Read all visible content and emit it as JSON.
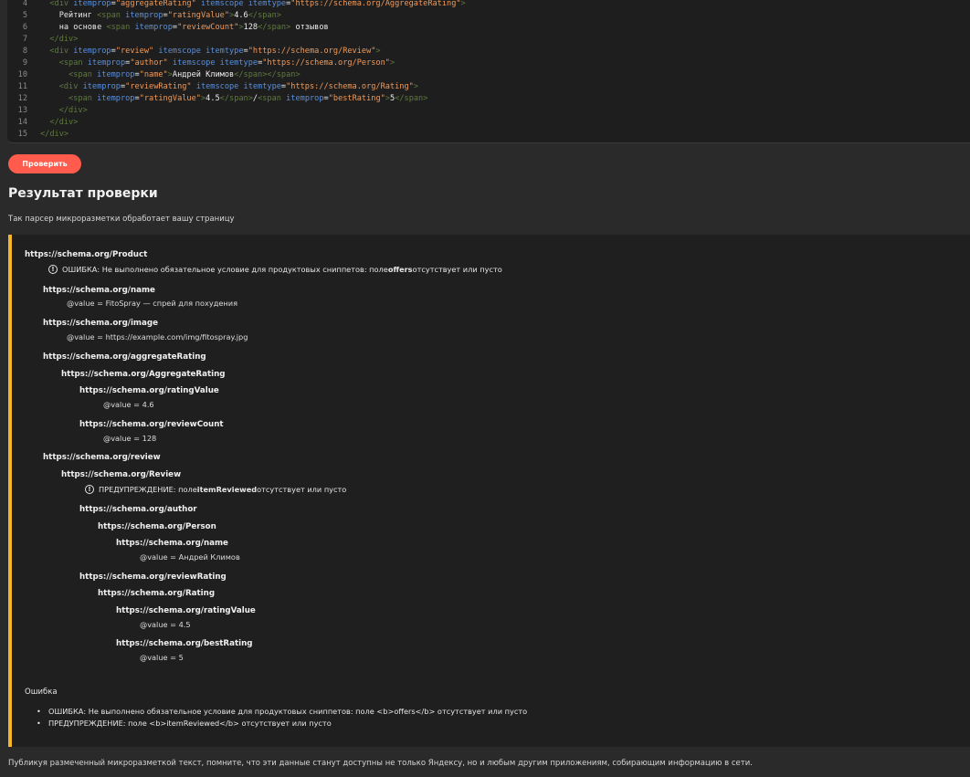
{
  "code": {
    "lines": [
      {
        "n": "4",
        "parts": [
          {
            "c": "tag",
            "t": "  <div "
          },
          {
            "c": "attr",
            "t": "itemprop"
          },
          {
            "c": "txt",
            "t": "="
          },
          {
            "c": "str",
            "t": "\"aggregateRating\""
          },
          {
            "c": "attr",
            "t": " itemscope itemtype"
          },
          {
            "c": "txt",
            "t": "="
          },
          {
            "c": "str",
            "t": "\"https://schema.org/AggregateRating\""
          },
          {
            "c": "tag",
            "t": ">"
          }
        ]
      },
      {
        "n": "5",
        "parts": [
          {
            "c": "txt",
            "t": "    Рейтинг "
          },
          {
            "c": "tag",
            "t": "<span "
          },
          {
            "c": "attr",
            "t": "itemprop"
          },
          {
            "c": "txt",
            "t": "="
          },
          {
            "c": "str",
            "t": "\"ratingValue\""
          },
          {
            "c": "tag",
            "t": ">"
          },
          {
            "c": "txt",
            "t": "4.6"
          },
          {
            "c": "tag",
            "t": "</span>"
          }
        ]
      },
      {
        "n": "6",
        "parts": [
          {
            "c": "txt",
            "t": "    на основе "
          },
          {
            "c": "tag",
            "t": "<span "
          },
          {
            "c": "attr",
            "t": "itemprop"
          },
          {
            "c": "txt",
            "t": "="
          },
          {
            "c": "str",
            "t": "\"reviewCount\""
          },
          {
            "c": "tag",
            "t": ">"
          },
          {
            "c": "txt",
            "t": "128"
          },
          {
            "c": "tag",
            "t": "</span>"
          },
          {
            "c": "txt",
            "t": " отзывов"
          }
        ]
      },
      {
        "n": "7",
        "parts": [
          {
            "c": "tag",
            "t": "  </div>"
          }
        ]
      },
      {
        "n": "8",
        "parts": [
          {
            "c": "tag",
            "t": "  <div "
          },
          {
            "c": "attr",
            "t": "itemprop"
          },
          {
            "c": "txt",
            "t": "="
          },
          {
            "c": "str",
            "t": "\"review\""
          },
          {
            "c": "attr",
            "t": " itemscope itemtype"
          },
          {
            "c": "txt",
            "t": "="
          },
          {
            "c": "str",
            "t": "\"https://schema.org/Review\""
          },
          {
            "c": "tag",
            "t": ">"
          }
        ]
      },
      {
        "n": "9",
        "parts": [
          {
            "c": "tag",
            "t": "    <span "
          },
          {
            "c": "attr",
            "t": "itemprop"
          },
          {
            "c": "txt",
            "t": "="
          },
          {
            "c": "str",
            "t": "\"author\""
          },
          {
            "c": "attr",
            "t": " itemscope itemtype"
          },
          {
            "c": "txt",
            "t": "="
          },
          {
            "c": "str",
            "t": "\"https://schema.org/Person\""
          },
          {
            "c": "tag",
            "t": ">"
          }
        ]
      },
      {
        "n": "10",
        "parts": [
          {
            "c": "tag",
            "t": "      <span "
          },
          {
            "c": "attr",
            "t": "itemprop"
          },
          {
            "c": "txt",
            "t": "="
          },
          {
            "c": "str",
            "t": "\"name\""
          },
          {
            "c": "tag",
            "t": ">"
          },
          {
            "c": "txt",
            "t": "Андрей Климов"
          },
          {
            "c": "tag",
            "t": "</span></span>"
          }
        ]
      },
      {
        "n": "11",
        "parts": [
          {
            "c": "tag",
            "t": "    <div "
          },
          {
            "c": "attr",
            "t": "itemprop"
          },
          {
            "c": "txt",
            "t": "="
          },
          {
            "c": "str",
            "t": "\"reviewRating\""
          },
          {
            "c": "attr",
            "t": " itemscope itemtype"
          },
          {
            "c": "txt",
            "t": "="
          },
          {
            "c": "str",
            "t": "\"https://schema.org/Rating\""
          },
          {
            "c": "tag",
            "t": ">"
          }
        ]
      },
      {
        "n": "12",
        "parts": [
          {
            "c": "tag",
            "t": "      <span "
          },
          {
            "c": "attr",
            "t": "itemprop"
          },
          {
            "c": "txt",
            "t": "="
          },
          {
            "c": "str",
            "t": "\"ratingValue\""
          },
          {
            "c": "tag",
            "t": ">"
          },
          {
            "c": "txt",
            "t": "4.5"
          },
          {
            "c": "tag",
            "t": "</span>"
          },
          {
            "c": "txt",
            "t": "/"
          },
          {
            "c": "tag",
            "t": "<span "
          },
          {
            "c": "attr",
            "t": "itemprop"
          },
          {
            "c": "txt",
            "t": "="
          },
          {
            "c": "str",
            "t": "\"bestRating\""
          },
          {
            "c": "tag",
            "t": ">"
          },
          {
            "c": "txt",
            "t": "5"
          },
          {
            "c": "tag",
            "t": "</span>"
          }
        ]
      },
      {
        "n": "13",
        "parts": [
          {
            "c": "tag",
            "t": "    </div>"
          }
        ]
      },
      {
        "n": "14",
        "parts": [
          {
            "c": "tag",
            "t": "  </div>"
          }
        ]
      },
      {
        "n": "15",
        "parts": [
          {
            "c": "tag",
            "t": "</div>"
          }
        ]
      }
    ]
  },
  "check_button": "Проверить",
  "result_title": "Результат проверки",
  "result_subtitle": "Так парсер микроразметки обработает вашу страницу",
  "tree": [
    {
      "kind": "node",
      "level": 0,
      "text": "https://schema.org/Product"
    },
    {
      "kind": "msg",
      "level": 1,
      "prefix": "ОШИБКА: Не выполнено обязательное условие для продуктовых сниппетов: поле ",
      "bold": "offers",
      "suffix": " отсутствует или пусто"
    },
    {
      "kind": "node",
      "level": 1,
      "text": "https://schema.org/name"
    },
    {
      "kind": "val",
      "level": 2,
      "text": "@value = FitoSpray — спрей для похудения"
    },
    {
      "kind": "node",
      "level": 1,
      "text": "https://schema.org/image"
    },
    {
      "kind": "val",
      "level": 2,
      "text": "@value = https://example.com/img/fitospray.jpg"
    },
    {
      "kind": "node",
      "level": 1,
      "text": "https://schema.org/aggregateRating"
    },
    {
      "kind": "node",
      "level": 2,
      "text": "https://schema.org/AggregateRating"
    },
    {
      "kind": "node",
      "level": 3,
      "text": "https://schema.org/ratingValue"
    },
    {
      "kind": "val",
      "level": 4,
      "text": "@value = 4.6"
    },
    {
      "kind": "node",
      "level": 3,
      "text": "https://schema.org/reviewCount"
    },
    {
      "kind": "val",
      "level": 4,
      "text": "@value = 128"
    },
    {
      "kind": "node",
      "level": 1,
      "text": "https://schema.org/review"
    },
    {
      "kind": "node",
      "level": 2,
      "text": "https://schema.org/Review"
    },
    {
      "kind": "msg",
      "level": 3,
      "prefix": "ПРЕДУПРЕЖДЕНИЕ: поле ",
      "bold": "itemReviewed",
      "suffix": " отсутствует или пусто"
    },
    {
      "kind": "node",
      "level": 3,
      "text": "https://schema.org/author"
    },
    {
      "kind": "node",
      "level": 4,
      "text": "https://schema.org/Person"
    },
    {
      "kind": "node",
      "level": 5,
      "text": "https://schema.org/name"
    },
    {
      "kind": "val",
      "level": 6,
      "text": "@value = Андрей Климов"
    },
    {
      "kind": "node",
      "level": 3,
      "text": "https://schema.org/reviewRating"
    },
    {
      "kind": "node",
      "level": 4,
      "text": "https://schema.org/Rating"
    },
    {
      "kind": "node",
      "level": 5,
      "text": "https://schema.org/ratingValue"
    },
    {
      "kind": "val",
      "level": 6,
      "text": "@value = 4.5"
    },
    {
      "kind": "node",
      "level": 5,
      "text": "https://schema.org/bestRating"
    },
    {
      "kind": "val",
      "level": 6,
      "text": "@value = 5"
    }
  ],
  "errors_heading": "Ошибка",
  "errors": [
    "ОШИБКА: Не выполнено обязательное условие для продуктовых сниппетов: поле <b>offers</b> отсутствует или пусто",
    "ПРЕДУПРЕЖДЕНИЕ: поле <b>itemReviewed</b> отсутствует или пусто"
  ],
  "warning_icon": "info-circle-icon",
  "accent_color": "#f5b52a",
  "button_color": "#ff5c4d",
  "footer_note": "Публикуя размеченный микроразметкой текст, помните, что эти данные станут доступны не только Яндексу, но и любым другим приложениям, собирающим информацию в сети."
}
